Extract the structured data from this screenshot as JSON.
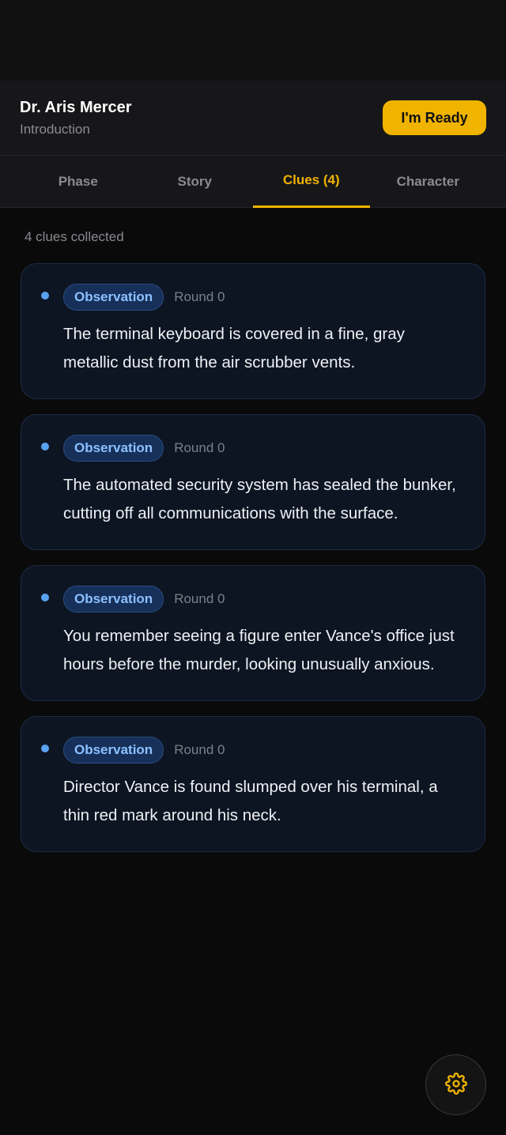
{
  "header": {
    "character_name": "Dr. Aris Mercer",
    "phase_name": "Introduction",
    "ready_label": "I'm Ready"
  },
  "tabs": [
    {
      "label": "Phase"
    },
    {
      "label": "Story"
    },
    {
      "label": "Clues (4)",
      "active": true
    },
    {
      "label": "Character"
    }
  ],
  "clues_summary": "4 clues collected",
  "clues": [
    {
      "type": "Observation",
      "round": "Round 0",
      "text": "The terminal keyboard is covered in a fine, gray metallic dust from the air scrubber vents."
    },
    {
      "type": "Observation",
      "round": "Round 0",
      "text": "The automated security system has sealed the bunker, cutting off all communications with the surface."
    },
    {
      "type": "Observation",
      "round": "Round 0",
      "text": "You remember seeing a figure enter Vance's office just hours before the murder, looking unusually anxious."
    },
    {
      "type": "Observation",
      "round": "Round 0",
      "text": "Director Vance is found slumped over his terminal, a thin red mark around his neck."
    }
  ],
  "settings_icon": "gear-icon",
  "colors": {
    "accent": "#f0b300",
    "badge_text": "#8cc0ff",
    "card_bg": "#0d1523"
  }
}
